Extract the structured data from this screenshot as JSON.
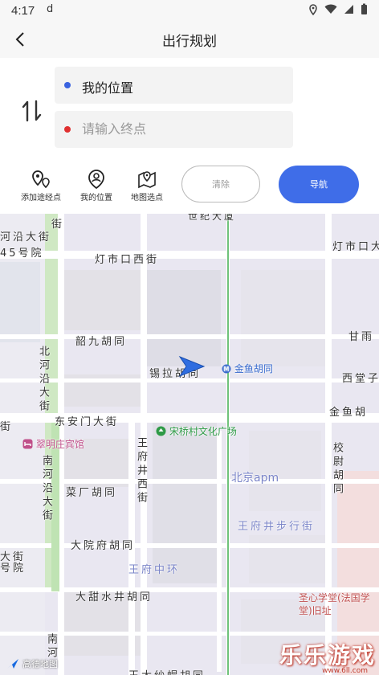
{
  "status_bar": {
    "time": "4:17",
    "sim_indicator": "d"
  },
  "header": {
    "title": "出行规划"
  },
  "route": {
    "start": {
      "value": "我的位置",
      "dot_color": "#3a63e0"
    },
    "end": {
      "placeholder": "请输入终点",
      "dot_color": "#e03030"
    }
  },
  "tools": {
    "add_waypoint": "添加途经点",
    "my_location": "我的位置",
    "pick_on_map": "地图选点"
  },
  "buttons": {
    "clear": "清除",
    "navigate": "导航"
  },
  "colors": {
    "accent": "#3f6de8"
  },
  "map": {
    "labels": {
      "top_building": "世纪大厦",
      "dengshikou_west": "灯市口西街",
      "dengshikou_dajie": "灯市口大",
      "hedajie": "河沿大街",
      "no45": "45号院",
      "shaojiu": "韶九胡同",
      "xila": "锡拉胡同",
      "jinyu_station": "金鱼胡同",
      "ganyu": "甘雨",
      "xitang": "西堂子",
      "jinyu_road": "金鱼胡",
      "beiheyan": "北河沿大街",
      "dongan": "东安门大街",
      "songqiao": "宋桥村文化广场",
      "cuiming": "翠明庄宾馆",
      "wangfujing_west": "王府井西街",
      "beijing_apm": "北京apm",
      "nanheyan": "南河沿大街",
      "caichang": "菜厂胡同",
      "wangfujing_walk": "王府井步行街",
      "xiaowei": "校尉胡同",
      "dayuanfu": "大院府胡同",
      "wangfu_central": "王府中环",
      "dajie_hao": "大街",
      "no_hao": "号院",
      "datianshui": "大甜水井胡同",
      "shengxin": "圣心学堂(法国学堂)旧址",
      "nanhe_bottom": "南河",
      "map_brand": "高德地图",
      "wangfu_bottom": "王大纱帽胡同",
      "ting_left": "街",
      "street_left": "街",
      "jie_top": "街"
    }
  },
  "watermark": {
    "text": "乐乐游戏",
    "url": "www.6ll.com"
  }
}
